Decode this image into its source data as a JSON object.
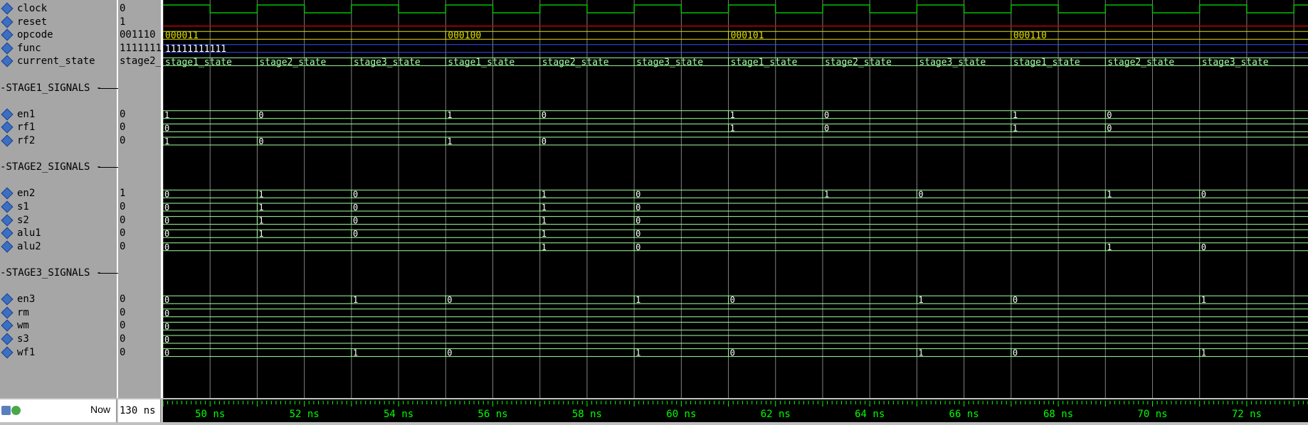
{
  "signals": [
    {
      "id": "clock",
      "name": "clock",
      "value": "0"
    },
    {
      "id": "reset",
      "name": "reset",
      "value": "1"
    },
    {
      "id": "opcode",
      "name": "opcode",
      "value": "001110"
    },
    {
      "id": "func",
      "name": "func",
      "value": "1111111"
    },
    {
      "id": "current_state",
      "name": "current_state",
      "value": "stage2_"
    }
  ],
  "groups": [
    {
      "name": "STAGE1_SIGNALS",
      "signals": [
        {
          "id": "en1",
          "name": "en1",
          "value": "0"
        },
        {
          "id": "rf1",
          "name": "rf1",
          "value": "0"
        },
        {
          "id": "rf2",
          "name": "rf2",
          "value": "0"
        }
      ]
    },
    {
      "name": "STAGE2_SIGNALS",
      "signals": [
        {
          "id": "en2",
          "name": "en2",
          "value": "1"
        },
        {
          "id": "s1",
          "name": "s1",
          "value": "0"
        },
        {
          "id": "s2",
          "name": "s2",
          "value": "0"
        },
        {
          "id": "alu1",
          "name": "alu1",
          "value": "0"
        },
        {
          "id": "alu2",
          "name": "alu2",
          "value": "0"
        }
      ]
    },
    {
      "name": "STAGE3_SIGNALS",
      "signals": [
        {
          "id": "en3",
          "name": "en3",
          "value": "0"
        },
        {
          "id": "rm",
          "name": "rm",
          "value": "0"
        },
        {
          "id": "wm",
          "name": "wm",
          "value": "0"
        },
        {
          "id": "s3",
          "name": "s3",
          "value": "0"
        },
        {
          "id": "wf1",
          "name": "wf1",
          "value": "0"
        }
      ]
    }
  ],
  "time": {
    "start_ns": 49.0,
    "end_ns": 73.3,
    "half_period_ns": 1.0,
    "labels": [
      "50 ns",
      "52 ns",
      "54 ns",
      "56 ns",
      "58 ns",
      "60 ns",
      "62 ns",
      "64 ns",
      "66 ns",
      "68 ns",
      "70 ns",
      "72 ns"
    ],
    "label_times": [
      50,
      52,
      54,
      56,
      58,
      60,
      62,
      64,
      66,
      68,
      70,
      72
    ]
  },
  "waveforms": {
    "clock": {
      "initial": 1,
      "toggle_ns": [
        50,
        51,
        52,
        53,
        54,
        55,
        56,
        57,
        58,
        59,
        60,
        61,
        62,
        63,
        64,
        65,
        66,
        67,
        68,
        69,
        70,
        71,
        72,
        73
      ]
    },
    "reset": {
      "constant": 1
    },
    "opcode": [
      {
        "t": 49.0,
        "text": "000011"
      },
      {
        "t": 55.0,
        "text": "000100"
      },
      {
        "t": 61.0,
        "text": "000101"
      },
      {
        "t": 67.0,
        "text": "000110"
      }
    ],
    "func": [
      {
        "t": 49.0,
        "text": "11111111111"
      }
    ],
    "current_state": [
      {
        "t": 49.0,
        "text": "stage1_state"
      },
      {
        "t": 51.0,
        "text": "stage2_state"
      },
      {
        "t": 53.0,
        "text": "stage3_state"
      },
      {
        "t": 55.0,
        "text": "stage1_state"
      },
      {
        "t": 57.0,
        "text": "stage2_state"
      },
      {
        "t": 59.0,
        "text": "stage3_state"
      },
      {
        "t": 61.0,
        "text": "stage1_state"
      },
      {
        "t": 63.0,
        "text": "stage2_state"
      },
      {
        "t": 65.0,
        "text": "stage3_state"
      },
      {
        "t": 67.0,
        "text": "stage1_state"
      },
      {
        "t": 69.0,
        "text": "stage2_state"
      },
      {
        "t": 71.0,
        "text": "stage3_state"
      }
    ],
    "en1": [
      {
        "t": 49.0,
        "v": "1"
      },
      {
        "t": 51.0,
        "v": "0"
      },
      {
        "t": 55.0,
        "v": "1"
      },
      {
        "t": 57.0,
        "v": "0"
      },
      {
        "t": 61.0,
        "v": "1"
      },
      {
        "t": 63.0,
        "v": "0"
      },
      {
        "t": 67.0,
        "v": "1"
      },
      {
        "t": 69.0,
        "v": "0"
      }
    ],
    "rf1": [
      {
        "t": 49.0,
        "v": "0"
      },
      {
        "t": 61.0,
        "v": "1"
      },
      {
        "t": 63.0,
        "v": "0"
      },
      {
        "t": 67.0,
        "v": "1"
      },
      {
        "t": 69.0,
        "v": "0"
      }
    ],
    "rf2": [
      {
        "t": 49.0,
        "v": "1"
      },
      {
        "t": 51.0,
        "v": "0"
      },
      {
        "t": 55.0,
        "v": "1"
      },
      {
        "t": 57.0,
        "v": "0"
      }
    ],
    "en2": [
      {
        "t": 49.0,
        "v": "0"
      },
      {
        "t": 51.0,
        "v": "1"
      },
      {
        "t": 53.0,
        "v": "0"
      },
      {
        "t": 57.0,
        "v": "1"
      },
      {
        "t": 59.0,
        "v": "0"
      },
      {
        "t": 63.0,
        "v": "1"
      },
      {
        "t": 65.0,
        "v": "0"
      },
      {
        "t": 69.0,
        "v": "1"
      },
      {
        "t": 71.0,
        "v": "0"
      }
    ],
    "s1": [
      {
        "t": 49.0,
        "v": "0"
      },
      {
        "t": 51.0,
        "v": "1"
      },
      {
        "t": 53.0,
        "v": "0"
      },
      {
        "t": 57.0,
        "v": "1"
      },
      {
        "t": 59.0,
        "v": "0"
      }
    ],
    "s2": [
      {
        "t": 49.0,
        "v": "0"
      },
      {
        "t": 51.0,
        "v": "1"
      },
      {
        "t": 53.0,
        "v": "0"
      },
      {
        "t": 57.0,
        "v": "1"
      },
      {
        "t": 59.0,
        "v": "0"
      }
    ],
    "alu1": [
      {
        "t": 49.0,
        "v": "0"
      },
      {
        "t": 51.0,
        "v": "1"
      },
      {
        "t": 53.0,
        "v": "0"
      },
      {
        "t": 57.0,
        "v": "1"
      },
      {
        "t": 59.0,
        "v": "0"
      }
    ],
    "alu2": [
      {
        "t": 49.0,
        "v": "0"
      },
      {
        "t": 57.0,
        "v": "1"
      },
      {
        "t": 59.0,
        "v": "0"
      },
      {
        "t": 69.0,
        "v": "1"
      },
      {
        "t": 71.0,
        "v": "0"
      }
    ],
    "en3": [
      {
        "t": 49.0,
        "v": "0"
      },
      {
        "t": 53.0,
        "v": "1"
      },
      {
        "t": 55.0,
        "v": "0"
      },
      {
        "t": 59.0,
        "v": "1"
      },
      {
        "t": 61.0,
        "v": "0"
      },
      {
        "t": 65.0,
        "v": "1"
      },
      {
        "t": 67.0,
        "v": "0"
      },
      {
        "t": 71.0,
        "v": "1"
      }
    ],
    "rm": [
      {
        "t": 49.0,
        "v": "0"
      }
    ],
    "wm": [
      {
        "t": 49.0,
        "v": "0"
      }
    ],
    "s3": [
      {
        "t": 49.0,
        "v": "0"
      }
    ],
    "wf1": [
      {
        "t": 49.0,
        "v": "0"
      },
      {
        "t": 53.0,
        "v": "1"
      },
      {
        "t": 55.0,
        "v": "0"
      },
      {
        "t": 59.0,
        "v": "1"
      },
      {
        "t": 61.0,
        "v": "0"
      },
      {
        "t": 65.0,
        "v": "1"
      },
      {
        "t": 67.0,
        "v": "0"
      },
      {
        "t": 71.0,
        "v": "1"
      }
    ]
  },
  "footer": {
    "now_label": "Now",
    "now_value": "130 ns"
  },
  "colors": {
    "clock": "#00c000",
    "reset": "#c00000",
    "opcode": "#e0e000",
    "func": "#3050ff",
    "bus": "#a0ffa0",
    "grid": "#808080",
    "ruler_text": "#00ff00"
  }
}
